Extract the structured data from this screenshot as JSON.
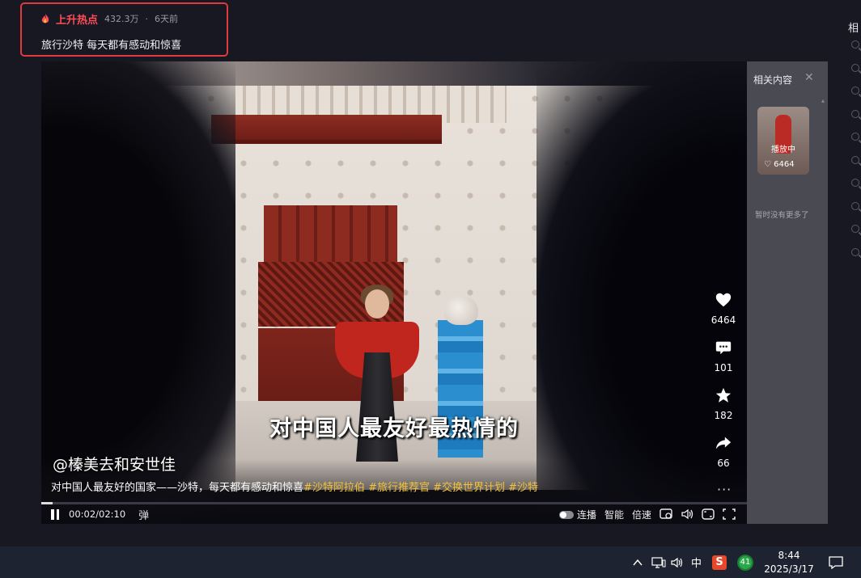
{
  "hot": {
    "label": "上升热点",
    "views": "432.3万",
    "separator": "·",
    "age": "6天前",
    "title": "旅行沙特 每天都有感动和惊喜"
  },
  "right_column": {
    "title_partial": "相"
  },
  "video": {
    "subtitle": "对中国人最友好最热情的",
    "author": "@榛美去和安世佳",
    "description_text": "对中国人最友好的国家——沙特，每天都有感动和惊喜",
    "tags": [
      "#沙特阿拉伯",
      "#旅行推荐官",
      "#交换世界计划",
      "#沙特"
    ],
    "likes": "6464",
    "comments": "101",
    "favorites": "182",
    "shares": "66",
    "more": "···",
    "progress_fraction": 0.0159
  },
  "controls": {
    "time": "00:02/02:10",
    "danmaku": "弹",
    "autoplay_label": "连播",
    "smart_label": "智能",
    "speed_label": "倍速"
  },
  "related": {
    "title": "相关内容",
    "close": "✕",
    "thumb_playing": "播放中",
    "thumb_likes": "6464",
    "empty_text": "暂时没有更多了"
  },
  "taskbar": {
    "ime": "中",
    "sogou": "S",
    "badge": "41",
    "time": "8:44",
    "date": "2025/3/17"
  },
  "colors": {
    "hot_red": "#ff4d57",
    "box_border": "#e0393e",
    "tag_yellow": "#f3c33b",
    "background": "#171822"
  }
}
